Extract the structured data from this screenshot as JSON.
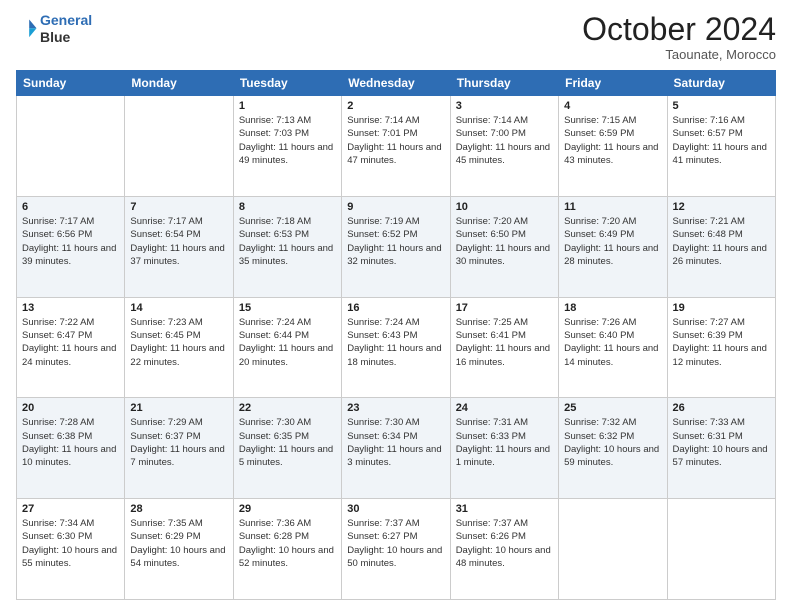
{
  "header": {
    "logo_line1": "General",
    "logo_line2": "Blue",
    "month_title": "October 2024",
    "subtitle": "Taounate, Morocco"
  },
  "days_of_week": [
    "Sunday",
    "Monday",
    "Tuesday",
    "Wednesday",
    "Thursday",
    "Friday",
    "Saturday"
  ],
  "weeks": [
    [
      {
        "day": "",
        "sunrise": "",
        "sunset": "",
        "daylight": ""
      },
      {
        "day": "",
        "sunrise": "",
        "sunset": "",
        "daylight": ""
      },
      {
        "day": "1",
        "sunrise": "Sunrise: 7:13 AM",
        "sunset": "Sunset: 7:03 PM",
        "daylight": "Daylight: 11 hours and 49 minutes."
      },
      {
        "day": "2",
        "sunrise": "Sunrise: 7:14 AM",
        "sunset": "Sunset: 7:01 PM",
        "daylight": "Daylight: 11 hours and 47 minutes."
      },
      {
        "day": "3",
        "sunrise": "Sunrise: 7:14 AM",
        "sunset": "Sunset: 7:00 PM",
        "daylight": "Daylight: 11 hours and 45 minutes."
      },
      {
        "day": "4",
        "sunrise": "Sunrise: 7:15 AM",
        "sunset": "Sunset: 6:59 PM",
        "daylight": "Daylight: 11 hours and 43 minutes."
      },
      {
        "day": "5",
        "sunrise": "Sunrise: 7:16 AM",
        "sunset": "Sunset: 6:57 PM",
        "daylight": "Daylight: 11 hours and 41 minutes."
      }
    ],
    [
      {
        "day": "6",
        "sunrise": "Sunrise: 7:17 AM",
        "sunset": "Sunset: 6:56 PM",
        "daylight": "Daylight: 11 hours and 39 minutes."
      },
      {
        "day": "7",
        "sunrise": "Sunrise: 7:17 AM",
        "sunset": "Sunset: 6:54 PM",
        "daylight": "Daylight: 11 hours and 37 minutes."
      },
      {
        "day": "8",
        "sunrise": "Sunrise: 7:18 AM",
        "sunset": "Sunset: 6:53 PM",
        "daylight": "Daylight: 11 hours and 35 minutes."
      },
      {
        "day": "9",
        "sunrise": "Sunrise: 7:19 AM",
        "sunset": "Sunset: 6:52 PM",
        "daylight": "Daylight: 11 hours and 32 minutes."
      },
      {
        "day": "10",
        "sunrise": "Sunrise: 7:20 AM",
        "sunset": "Sunset: 6:50 PM",
        "daylight": "Daylight: 11 hours and 30 minutes."
      },
      {
        "day": "11",
        "sunrise": "Sunrise: 7:20 AM",
        "sunset": "Sunset: 6:49 PM",
        "daylight": "Daylight: 11 hours and 28 minutes."
      },
      {
        "day": "12",
        "sunrise": "Sunrise: 7:21 AM",
        "sunset": "Sunset: 6:48 PM",
        "daylight": "Daylight: 11 hours and 26 minutes."
      }
    ],
    [
      {
        "day": "13",
        "sunrise": "Sunrise: 7:22 AM",
        "sunset": "Sunset: 6:47 PM",
        "daylight": "Daylight: 11 hours and 24 minutes."
      },
      {
        "day": "14",
        "sunrise": "Sunrise: 7:23 AM",
        "sunset": "Sunset: 6:45 PM",
        "daylight": "Daylight: 11 hours and 22 minutes."
      },
      {
        "day": "15",
        "sunrise": "Sunrise: 7:24 AM",
        "sunset": "Sunset: 6:44 PM",
        "daylight": "Daylight: 11 hours and 20 minutes."
      },
      {
        "day": "16",
        "sunrise": "Sunrise: 7:24 AM",
        "sunset": "Sunset: 6:43 PM",
        "daylight": "Daylight: 11 hours and 18 minutes."
      },
      {
        "day": "17",
        "sunrise": "Sunrise: 7:25 AM",
        "sunset": "Sunset: 6:41 PM",
        "daylight": "Daylight: 11 hours and 16 minutes."
      },
      {
        "day": "18",
        "sunrise": "Sunrise: 7:26 AM",
        "sunset": "Sunset: 6:40 PM",
        "daylight": "Daylight: 11 hours and 14 minutes."
      },
      {
        "day": "19",
        "sunrise": "Sunrise: 7:27 AM",
        "sunset": "Sunset: 6:39 PM",
        "daylight": "Daylight: 11 hours and 12 minutes."
      }
    ],
    [
      {
        "day": "20",
        "sunrise": "Sunrise: 7:28 AM",
        "sunset": "Sunset: 6:38 PM",
        "daylight": "Daylight: 11 hours and 10 minutes."
      },
      {
        "day": "21",
        "sunrise": "Sunrise: 7:29 AM",
        "sunset": "Sunset: 6:37 PM",
        "daylight": "Daylight: 11 hours and 7 minutes."
      },
      {
        "day": "22",
        "sunrise": "Sunrise: 7:30 AM",
        "sunset": "Sunset: 6:35 PM",
        "daylight": "Daylight: 11 hours and 5 minutes."
      },
      {
        "day": "23",
        "sunrise": "Sunrise: 7:30 AM",
        "sunset": "Sunset: 6:34 PM",
        "daylight": "Daylight: 11 hours and 3 minutes."
      },
      {
        "day": "24",
        "sunrise": "Sunrise: 7:31 AM",
        "sunset": "Sunset: 6:33 PM",
        "daylight": "Daylight: 11 hours and 1 minute."
      },
      {
        "day": "25",
        "sunrise": "Sunrise: 7:32 AM",
        "sunset": "Sunset: 6:32 PM",
        "daylight": "Daylight: 10 hours and 59 minutes."
      },
      {
        "day": "26",
        "sunrise": "Sunrise: 7:33 AM",
        "sunset": "Sunset: 6:31 PM",
        "daylight": "Daylight: 10 hours and 57 minutes."
      }
    ],
    [
      {
        "day": "27",
        "sunrise": "Sunrise: 7:34 AM",
        "sunset": "Sunset: 6:30 PM",
        "daylight": "Daylight: 10 hours and 55 minutes."
      },
      {
        "day": "28",
        "sunrise": "Sunrise: 7:35 AM",
        "sunset": "Sunset: 6:29 PM",
        "daylight": "Daylight: 10 hours and 54 minutes."
      },
      {
        "day": "29",
        "sunrise": "Sunrise: 7:36 AM",
        "sunset": "Sunset: 6:28 PM",
        "daylight": "Daylight: 10 hours and 52 minutes."
      },
      {
        "day": "30",
        "sunrise": "Sunrise: 7:37 AM",
        "sunset": "Sunset: 6:27 PM",
        "daylight": "Daylight: 10 hours and 50 minutes."
      },
      {
        "day": "31",
        "sunrise": "Sunrise: 7:37 AM",
        "sunset": "Sunset: 6:26 PM",
        "daylight": "Daylight: 10 hours and 48 minutes."
      },
      {
        "day": "",
        "sunrise": "",
        "sunset": "",
        "daylight": ""
      },
      {
        "day": "",
        "sunrise": "",
        "sunset": "",
        "daylight": ""
      }
    ]
  ]
}
